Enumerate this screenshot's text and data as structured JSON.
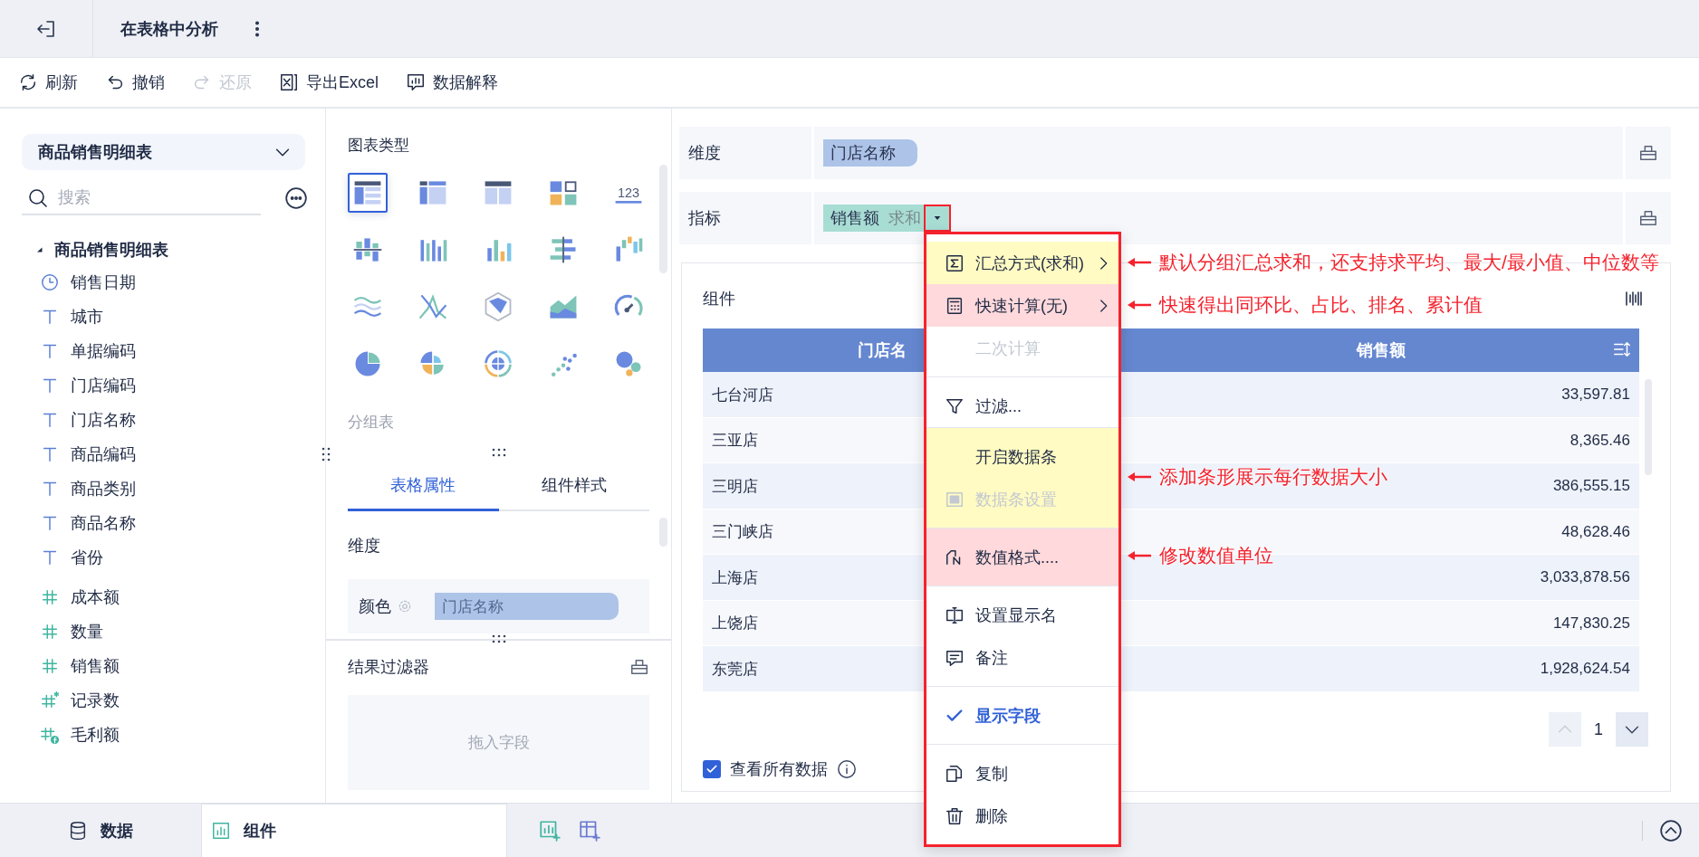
{
  "window": {
    "title": "在表格中分析"
  },
  "toolbar": [
    {
      "kind": "refresh",
      "label": "刷新",
      "disabled": false
    },
    {
      "kind": "undo",
      "label": "撤销",
      "disabled": false
    },
    {
      "kind": "redo",
      "label": "还原",
      "disabled": true
    },
    {
      "kind": "excel",
      "label": "导出Excel",
      "disabled": false
    },
    {
      "kind": "explain",
      "label": "数据解释",
      "disabled": false
    }
  ],
  "data_panel": {
    "dataset": "商品销售明细表",
    "search": {
      "placeholder": "搜索"
    },
    "tree": {
      "label": "商品销售明细表",
      "expanded": true,
      "children": [
        {
          "kind": "date",
          "label": "销售日期"
        },
        {
          "kind": "text",
          "label": "城市"
        },
        {
          "kind": "text",
          "label": "单据编码"
        },
        {
          "kind": "text",
          "label": "门店编码"
        },
        {
          "kind": "text",
          "label": "门店名称"
        },
        {
          "kind": "text",
          "label": "商品编码"
        },
        {
          "kind": "text",
          "label": "商品类别"
        },
        {
          "kind": "text",
          "label": "商品名称"
        },
        {
          "kind": "text",
          "label": "省份"
        },
        {
          "kind": "number",
          "label": "成本额"
        },
        {
          "kind": "number",
          "label": "数量"
        },
        {
          "kind": "number",
          "label": "销售额"
        },
        {
          "kind": "count",
          "label": "记录数"
        },
        {
          "kind": "calc",
          "label": "毛利额"
        }
      ]
    }
  },
  "chart_panel": {
    "title": "图表类型",
    "chart_types": [
      {
        "kind": "table",
        "selected": true
      },
      {
        "kind": "crosstab",
        "selected": false
      },
      {
        "kind": "detail",
        "selected": false
      },
      {
        "kind": "card",
        "selected": false
      },
      {
        "kind": "number",
        "text": "123",
        "selected": false
      },
      {
        "kind": "stacked-bar",
        "selected": false
      },
      {
        "kind": "grouped-bar",
        "selected": false
      },
      {
        "kind": "bar",
        "selected": false
      },
      {
        "kind": "bidirectional",
        "selected": false
      },
      {
        "kind": "waterfall",
        "selected": false
      },
      {
        "kind": "stream",
        "selected": false
      },
      {
        "kind": "line",
        "selected": false
      },
      {
        "kind": "radar",
        "selected": false
      },
      {
        "kind": "area",
        "selected": false
      },
      {
        "kind": "gauge",
        "selected": false
      },
      {
        "kind": "pie",
        "selected": false
      },
      {
        "kind": "rose",
        "selected": false
      },
      {
        "kind": "radial",
        "selected": false
      },
      {
        "kind": "scatter",
        "selected": false
      },
      {
        "kind": "bubble",
        "selected": false
      }
    ],
    "chart_name": "分组表",
    "tabs": [
      {
        "label": "表格属性",
        "selected": true
      },
      {
        "label": "组件样式",
        "selected": false
      }
    ],
    "section": "维度",
    "color_field": {
      "label": "颜色",
      "value": "门店名称"
    }
  },
  "result_filter": {
    "title": "结果过滤器",
    "hint": "拖入字段"
  },
  "dimension": {
    "label": "维度",
    "fields": [
      "门店名称"
    ]
  },
  "measure": {
    "label": "指标",
    "fields": [
      {
        "name": "销售额",
        "aggregation": "求和"
      }
    ]
  },
  "component": {
    "title": "组件",
    "table": {
      "columns": [
        "门店名",
        "销售额"
      ],
      "rows": [
        [
          "七台河店",
          "33,597.81"
        ],
        [
          "三亚店",
          "8,365.46"
        ],
        [
          "三明店",
          "386,555.15"
        ],
        [
          "三门峡店",
          "48,628.46"
        ],
        [
          "上海店",
          "3,033,878.56"
        ],
        [
          "上饶店",
          "147,830.25"
        ],
        [
          "东莞店",
          "1,928,624.54"
        ]
      ]
    },
    "page": "1",
    "show_all": {
      "label": "查看所有数据",
      "checked": true
    }
  },
  "context_menu": {
    "sections": [
      {
        "items": [
          {
            "kind": "aggregate",
            "label": "汇总方式(求和)",
            "disabled": false,
            "checked": false,
            "submenu": true,
            "color": "#fffbc2",
            "note": "默认分组汇总求和，还支持求平均、最大/最小值、中位数等"
          },
          {
            "kind": "quick-calc",
            "label": "快速计算(无)",
            "disabled": false,
            "checked": false,
            "submenu": true,
            "color": "#ffd9db",
            "note": "快速得出同环比、占比、排名、累计值"
          },
          {
            "kind": "secondary",
            "label": "二次计算",
            "disabled": true,
            "checked": false,
            "submenu": false
          }
        ]
      },
      {
        "items": [
          {
            "kind": "filter",
            "label": "过滤...",
            "disabled": false,
            "checked": false,
            "submenu": false
          }
        ]
      },
      {
        "color": "#fffbc2",
        "note": "添加条形展示每行数据大小",
        "items": [
          {
            "kind": "databar",
            "label": "开启数据条",
            "disabled": false,
            "checked": false,
            "submenu": false
          },
          {
            "kind": "databar-settings",
            "label": "数据条设置",
            "disabled": true,
            "checked": false,
            "submenu": false
          }
        ]
      },
      {
        "color": "#ffd9db",
        "note": "修改数值单位",
        "items": [
          {
            "kind": "format",
            "label": "数值格式....",
            "disabled": false,
            "checked": false,
            "submenu": false
          }
        ]
      },
      {
        "items": [
          {
            "kind": "rename",
            "label": "设置显示名",
            "disabled": false,
            "checked": false,
            "submenu": false
          },
          {
            "kind": "note",
            "label": "备注",
            "disabled": false,
            "checked": false,
            "submenu": false
          }
        ]
      },
      {
        "items": [
          {
            "kind": "show-field",
            "label": "显示字段",
            "disabled": false,
            "checked": true,
            "submenu": false
          }
        ]
      },
      {
        "items": [
          {
            "kind": "copy",
            "label": "复制",
            "disabled": false,
            "checked": false,
            "submenu": false
          },
          {
            "kind": "delete",
            "label": "删除",
            "disabled": false,
            "checked": false,
            "submenu": false
          }
        ]
      }
    ]
  },
  "bottom_tabs": [
    {
      "kind": "data",
      "label": "数据",
      "selected": false
    },
    {
      "kind": "component",
      "label": "组件",
      "selected": true
    }
  ]
}
